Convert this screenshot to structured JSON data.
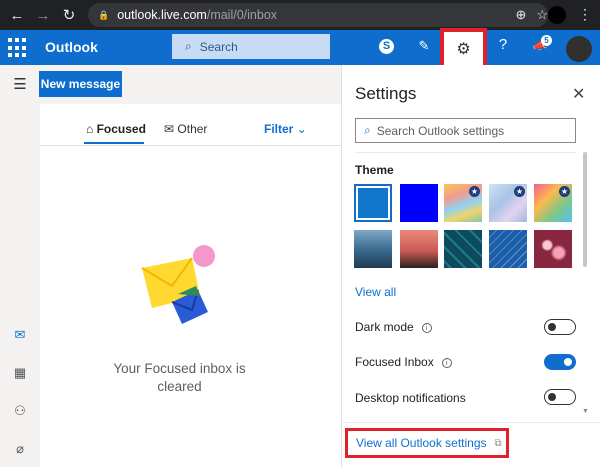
{
  "browser": {
    "back_glyph": "←",
    "forward_glyph": "→",
    "reload_glyph": "↻",
    "lock_glyph": "🔒",
    "url_host": "outlook.live.com",
    "url_path": "/mail/0/inbox",
    "add_glyph": "⊕",
    "star_glyph": "☆",
    "menu_glyph": "⋮"
  },
  "header": {
    "brand": "Outlook",
    "search_placeholder": "Search",
    "skype_glyph": "S",
    "compose_glyph": "✎",
    "gear_glyph": "⚙",
    "help_glyph": "?",
    "megaphone_glyph": "📣",
    "notif_count": "5"
  },
  "toolbar": {
    "new_message_label": "New message"
  },
  "mail_list": {
    "tab_focused": "Focused",
    "tab_other": "Other",
    "filter_label": "Filter",
    "empty_text": "Your Focused inbox is cleared"
  },
  "rail": {
    "menu_glyph": "☰",
    "mail_glyph": "✉",
    "calendar_glyph": "▦",
    "people_glyph": "⚇",
    "attach_glyph": "⌀"
  },
  "settings": {
    "title": "Settings",
    "close_glyph": "✕",
    "search_placeholder": "Search Outlook settings",
    "theme_label": "Theme",
    "view_all_label": "View all",
    "dark_mode_label": "Dark mode",
    "dark_mode_on": false,
    "focused_inbox_label": "Focused Inbox",
    "focused_inbox_on": true,
    "desktop_notifications_label": "Desktop notifications",
    "desktop_notifications_on": false,
    "view_all_settings_label": "View all Outlook settings",
    "themes_row1": [
      "#1177cc",
      "#0000ff",
      "rainbow",
      "unicorn",
      "balloons"
    ],
    "themes_row2": [
      "ocean",
      "palms",
      "circuit",
      "blueprint",
      "bokeh"
    ]
  },
  "colors": {
    "brand_blue": "#0f6ecd",
    "highlight_red": "#e0202a"
  }
}
